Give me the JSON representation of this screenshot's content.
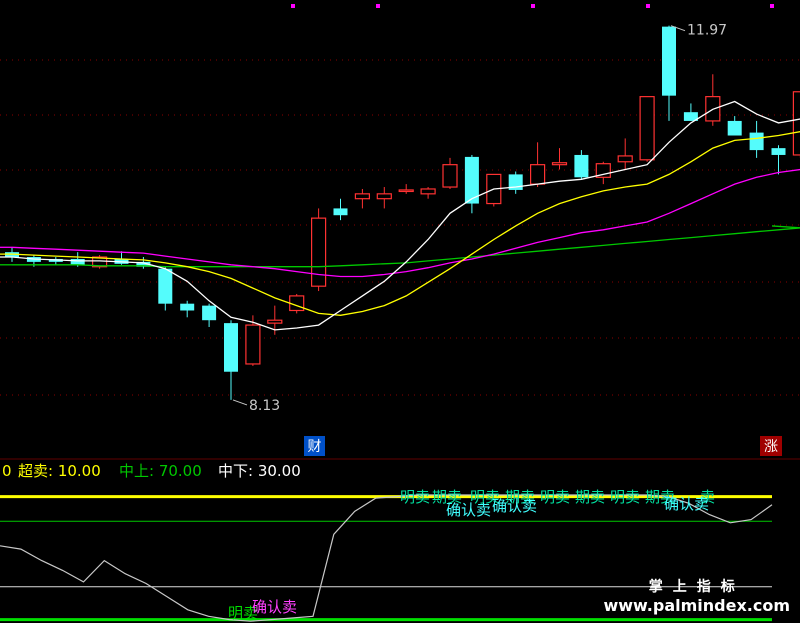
{
  "colors": {
    "bg": "#000000",
    "up": "#ff3232",
    "down": "#54fcfc",
    "ma5": "#ffffff",
    "ma10": "#ffff00",
    "ma20": "#ff00ff",
    "ma60": "#00c800",
    "osc": "#c8c8c8",
    "level_hi": "#ffff00",
    "level_mid": "#00c800",
    "level_low": "#00e000",
    "signal_text": "#00e0a0",
    "signal_confirm": "#40ffff",
    "bottom_signal": "#ff40ff"
  },
  "markers": {
    "high_label": "11.97",
    "low_label": "8.13",
    "cai_badge": "财",
    "zhang_badge": "涨"
  },
  "indicator_header": {
    "prefix": "0",
    "chaomai_label": "超卖: 10.00",
    "zhongshang_label": "中上: 70.00",
    "zhongxia_label": "中下: 30.00"
  },
  "signals": {
    "top_texts": [
      "明卖",
      "期卖",
      "明卖",
      "期卖",
      "明卖",
      "期卖",
      "明卖",
      "期卖",
      "卖"
    ],
    "top_confirm": [
      "确认卖",
      "确认卖",
      "确认卖"
    ],
    "bottom_texts": [
      "明卖",
      "确认卖"
    ]
  },
  "brand": {
    "cn": "掌上指标",
    "url": "www.palmindex.com"
  },
  "chart_data": {
    "type": "candlestick",
    "price_range": [
      7.8,
      12.1
    ],
    "candles": [
      {
        "o": 9.65,
        "h": 9.7,
        "l": 9.55,
        "c": 9.6
      },
      {
        "o": 9.6,
        "h": 9.62,
        "l": 9.5,
        "c": 9.55
      },
      {
        "o": 9.58,
        "h": 9.6,
        "l": 9.52,
        "c": 9.55
      },
      {
        "o": 9.58,
        "h": 9.65,
        "l": 9.5,
        "c": 9.52
      },
      {
        "o": 9.5,
        "h": 9.62,
        "l": 9.48,
        "c": 9.6
      },
      {
        "o": 9.58,
        "h": 9.66,
        "l": 9.52,
        "c": 9.53
      },
      {
        "o": 9.55,
        "h": 9.6,
        "l": 9.48,
        "c": 9.5
      },
      {
        "o": 9.48,
        "h": 9.5,
        "l": 9.05,
        "c": 9.12
      },
      {
        "o": 9.12,
        "h": 9.15,
        "l": 8.98,
        "c": 9.05
      },
      {
        "o": 9.1,
        "h": 9.12,
        "l": 8.88,
        "c": 8.95
      },
      {
        "o": 8.92,
        "h": 8.95,
        "l": 8.13,
        "c": 8.42
      },
      {
        "o": 8.5,
        "h": 9.0,
        "l": 8.48,
        "c": 8.9
      },
      {
        "o": 8.92,
        "h": 9.1,
        "l": 8.8,
        "c": 8.95
      },
      {
        "o": 9.05,
        "h": 9.22,
        "l": 9.02,
        "c": 9.2
      },
      {
        "o": 9.3,
        "h": 10.1,
        "l": 9.25,
        "c": 10.0
      },
      {
        "o": 10.1,
        "h": 10.2,
        "l": 9.98,
        "c": 10.03
      },
      {
        "o": 10.2,
        "h": 10.3,
        "l": 10.1,
        "c": 10.25
      },
      {
        "o": 10.2,
        "h": 10.32,
        "l": 10.1,
        "c": 10.25
      },
      {
        "o": 10.28,
        "h": 10.35,
        "l": 10.25,
        "c": 10.29
      },
      {
        "o": 10.25,
        "h": 10.32,
        "l": 10.2,
        "c": 10.3
      },
      {
        "o": 10.32,
        "h": 10.62,
        "l": 10.3,
        "c": 10.55
      },
      {
        "o": 10.63,
        "h": 10.65,
        "l": 10.05,
        "c": 10.15
      },
      {
        "o": 10.15,
        "h": 10.45,
        "l": 10.12,
        "c": 10.45
      },
      {
        "o": 10.45,
        "h": 10.48,
        "l": 10.25,
        "c": 10.29
      },
      {
        "o": 10.35,
        "h": 10.78,
        "l": 10.32,
        "c": 10.55
      },
      {
        "o": 10.55,
        "h": 10.72,
        "l": 10.5,
        "c": 10.57
      },
      {
        "o": 10.65,
        "h": 10.7,
        "l": 10.4,
        "c": 10.42
      },
      {
        "o": 10.42,
        "h": 10.58,
        "l": 10.35,
        "c": 10.56
      },
      {
        "o": 10.58,
        "h": 10.82,
        "l": 10.5,
        "c": 10.64
      },
      {
        "o": 10.6,
        "h": 11.25,
        "l": 10.58,
        "c": 11.25
      },
      {
        "o": 11.97,
        "h": 11.98,
        "l": 11.0,
        "c": 11.26
      },
      {
        "o": 11.09,
        "h": 11.18,
        "l": 11.0,
        "c": 11.0
      },
      {
        "o": 11.0,
        "h": 11.48,
        "l": 10.95,
        "c": 11.25
      },
      {
        "o": 11.0,
        "h": 11.05,
        "l": 10.88,
        "c": 10.85
      },
      {
        "o": 10.88,
        "h": 11.0,
        "l": 10.62,
        "c": 10.7
      },
      {
        "o": 10.72,
        "h": 10.75,
        "l": 10.45,
        "c": 10.65
      },
      {
        "o": 10.65,
        "h": 11.3,
        "l": 10.62,
        "c": 11.3
      }
    ],
    "ma5": [
      9.6,
      9.58,
      9.57,
      9.56,
      9.56,
      9.55,
      9.54,
      9.48,
      9.35,
      9.15,
      8.98,
      8.93,
      8.85,
      8.87,
      8.9,
      9.05,
      9.2,
      9.35,
      9.55,
      9.78,
      10.05,
      10.2,
      10.3,
      10.32,
      10.35,
      10.38,
      10.4,
      10.45,
      10.5,
      10.55,
      10.78,
      10.98,
      11.12,
      11.2,
      11.07,
      10.98,
      11.02
    ],
    "ma10": [
      9.63,
      9.62,
      9.61,
      9.6,
      9.59,
      9.58,
      9.57,
      9.54,
      9.5,
      9.45,
      9.38,
      9.28,
      9.18,
      9.1,
      9.02,
      9.0,
      9.04,
      9.1,
      9.2,
      9.34,
      9.48,
      9.63,
      9.78,
      9.92,
      10.05,
      10.15,
      10.22,
      10.28,
      10.32,
      10.35,
      10.45,
      10.58,
      10.72,
      10.8,
      10.82,
      10.85,
      10.89
    ],
    "ma20": [
      9.7,
      9.69,
      9.68,
      9.67,
      9.66,
      9.65,
      9.64,
      9.61,
      9.58,
      9.55,
      9.52,
      9.5,
      9.48,
      9.45,
      9.42,
      9.4,
      9.4,
      9.42,
      9.45,
      9.49,
      9.54,
      9.58,
      9.63,
      9.69,
      9.75,
      9.8,
      9.85,
      9.88,
      9.92,
      9.96,
      10.05,
      10.15,
      10.25,
      10.35,
      10.42,
      10.47,
      10.5
    ],
    "ma60": [
      9.52,
      9.52,
      9.52,
      9.52,
      9.51,
      9.51,
      9.51,
      9.5,
      9.5,
      9.5,
      9.5,
      9.5,
      9.5,
      9.5,
      9.5,
      9.51,
      9.52,
      9.53,
      9.54,
      9.56,
      9.58,
      9.6,
      9.62,
      9.64,
      9.66,
      9.68,
      9.7,
      9.72,
      9.74,
      9.76,
      9.78,
      9.8,
      9.82,
      9.84,
      9.86,
      9.88,
      9.9
    ],
    "oscillator": {
      "range": [
        0,
        100
      ],
      "levels": {
        "chaomai": 10.0,
        "zhongshang": 70.0,
        "zhongxia": 30.0
      },
      "values": [
        55,
        53,
        46,
        40,
        33,
        46,
        38,
        32,
        24,
        16,
        12,
        10,
        9,
        10,
        11,
        12,
        62,
        76,
        84,
        85,
        86,
        86,
        86,
        86,
        86,
        86,
        86,
        86,
        86,
        86,
        86,
        86,
        85,
        81,
        74,
        69,
        71,
        80
      ]
    }
  }
}
